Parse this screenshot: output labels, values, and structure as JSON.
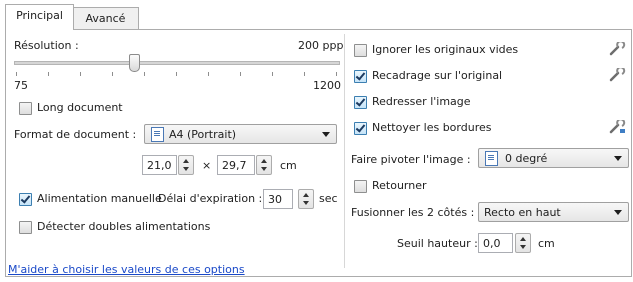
{
  "tabs": [
    {
      "label": "Principal",
      "active": true
    },
    {
      "label": "Avancé",
      "active": false
    }
  ],
  "left": {
    "resolution_label": "Résolution :",
    "resolution_value": "200 ppp",
    "slider_min": "75",
    "slider_max": "1200",
    "slider_position_fraction": 0.37,
    "long_document": {
      "label": "Long document",
      "checked": false
    },
    "doc_format_label": "Format de document :",
    "doc_format_value": "A4 (Portrait)",
    "width_value": "21,0",
    "times_sign": "×",
    "height_value": "29,7",
    "unit_cm": "cm",
    "manual_feed": {
      "label": "Alimentation manuelle",
      "checked": true
    },
    "timeout_label": "Délai d'expiration :",
    "timeout_value": "30",
    "timeout_unit": "sec",
    "double_feed": {
      "label": "Détecter doubles alimentations",
      "checked": false
    }
  },
  "right": {
    "ignore_blank": {
      "label": "Ignorer les originaux vides",
      "checked": false
    },
    "crop_original": {
      "label": "Recadrage sur l'original",
      "checked": true
    },
    "straighten": {
      "label": "Redresser l'image",
      "checked": true
    },
    "clean_borders": {
      "label": "Nettoyer les bordures",
      "checked": true
    },
    "rotate_label": "Faire pivoter l'image :",
    "rotate_value": "0 degré",
    "flip": {
      "label": "Retourner",
      "checked": false
    },
    "merge_label": "Fusionner les 2 côtés :",
    "merge_value": "Recto en haut",
    "threshold_label": "Seuil hauteur :",
    "threshold_value": "0,0",
    "threshold_unit": "cm"
  },
  "help_link": "M'aider à choisir les valeurs de ces options",
  "colors": {
    "link": "#1a49c8",
    "check_accent": "#3c7fb1"
  }
}
